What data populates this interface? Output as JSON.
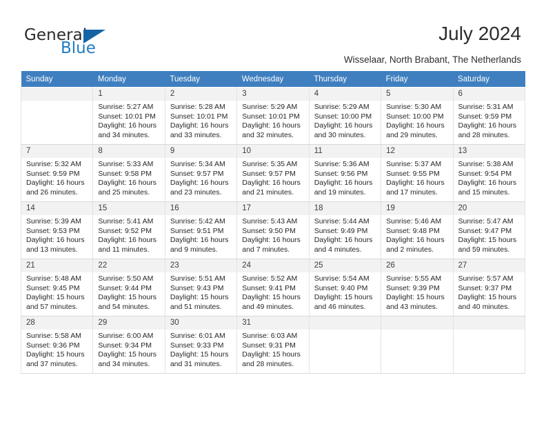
{
  "brand": {
    "name_top": "General",
    "name_bottom": "Blue",
    "accent_color": "#1464a5",
    "logo_icon": "triangle-icon"
  },
  "header": {
    "title": "July 2024",
    "subtitle": "Wisselaar, North Brabant, The Netherlands"
  },
  "calendar": {
    "header_bg": "#3f7fbf",
    "daynum_bg": "#f2f2f2",
    "weekdays": [
      "Sunday",
      "Monday",
      "Tuesday",
      "Wednesday",
      "Thursday",
      "Friday",
      "Saturday"
    ],
    "labels": {
      "sunrise": "Sunrise:",
      "sunset": "Sunset:",
      "daylight": "Daylight:"
    },
    "weeks": [
      [
        {
          "day": "",
          "empty": true
        },
        {
          "day": "1",
          "sunrise": "Sunrise: 5:27 AM",
          "sunset": "Sunset: 10:01 PM",
          "daylight": "Daylight: 16 hours and 34 minutes."
        },
        {
          "day": "2",
          "sunrise": "Sunrise: 5:28 AM",
          "sunset": "Sunset: 10:01 PM",
          "daylight": "Daylight: 16 hours and 33 minutes."
        },
        {
          "day": "3",
          "sunrise": "Sunrise: 5:29 AM",
          "sunset": "Sunset: 10:01 PM",
          "daylight": "Daylight: 16 hours and 32 minutes."
        },
        {
          "day": "4",
          "sunrise": "Sunrise: 5:29 AM",
          "sunset": "Sunset: 10:00 PM",
          "daylight": "Daylight: 16 hours and 30 minutes."
        },
        {
          "day": "5",
          "sunrise": "Sunrise: 5:30 AM",
          "sunset": "Sunset: 10:00 PM",
          "daylight": "Daylight: 16 hours and 29 minutes."
        },
        {
          "day": "6",
          "sunrise": "Sunrise: 5:31 AM",
          "sunset": "Sunset: 9:59 PM",
          "daylight": "Daylight: 16 hours and 28 minutes."
        }
      ],
      [
        {
          "day": "7",
          "sunrise": "Sunrise: 5:32 AM",
          "sunset": "Sunset: 9:59 PM",
          "daylight": "Daylight: 16 hours and 26 minutes."
        },
        {
          "day": "8",
          "sunrise": "Sunrise: 5:33 AM",
          "sunset": "Sunset: 9:58 PM",
          "daylight": "Daylight: 16 hours and 25 minutes."
        },
        {
          "day": "9",
          "sunrise": "Sunrise: 5:34 AM",
          "sunset": "Sunset: 9:57 PM",
          "daylight": "Daylight: 16 hours and 23 minutes."
        },
        {
          "day": "10",
          "sunrise": "Sunrise: 5:35 AM",
          "sunset": "Sunset: 9:57 PM",
          "daylight": "Daylight: 16 hours and 21 minutes."
        },
        {
          "day": "11",
          "sunrise": "Sunrise: 5:36 AM",
          "sunset": "Sunset: 9:56 PM",
          "daylight": "Daylight: 16 hours and 19 minutes."
        },
        {
          "day": "12",
          "sunrise": "Sunrise: 5:37 AM",
          "sunset": "Sunset: 9:55 PM",
          "daylight": "Daylight: 16 hours and 17 minutes."
        },
        {
          "day": "13",
          "sunrise": "Sunrise: 5:38 AM",
          "sunset": "Sunset: 9:54 PM",
          "daylight": "Daylight: 16 hours and 15 minutes."
        }
      ],
      [
        {
          "day": "14",
          "sunrise": "Sunrise: 5:39 AM",
          "sunset": "Sunset: 9:53 PM",
          "daylight": "Daylight: 16 hours and 13 minutes."
        },
        {
          "day": "15",
          "sunrise": "Sunrise: 5:41 AM",
          "sunset": "Sunset: 9:52 PM",
          "daylight": "Daylight: 16 hours and 11 minutes."
        },
        {
          "day": "16",
          "sunrise": "Sunrise: 5:42 AM",
          "sunset": "Sunset: 9:51 PM",
          "daylight": "Daylight: 16 hours and 9 minutes."
        },
        {
          "day": "17",
          "sunrise": "Sunrise: 5:43 AM",
          "sunset": "Sunset: 9:50 PM",
          "daylight": "Daylight: 16 hours and 7 minutes."
        },
        {
          "day": "18",
          "sunrise": "Sunrise: 5:44 AM",
          "sunset": "Sunset: 9:49 PM",
          "daylight": "Daylight: 16 hours and 4 minutes."
        },
        {
          "day": "19",
          "sunrise": "Sunrise: 5:46 AM",
          "sunset": "Sunset: 9:48 PM",
          "daylight": "Daylight: 16 hours and 2 minutes."
        },
        {
          "day": "20",
          "sunrise": "Sunrise: 5:47 AM",
          "sunset": "Sunset: 9:47 PM",
          "daylight": "Daylight: 15 hours and 59 minutes."
        }
      ],
      [
        {
          "day": "21",
          "sunrise": "Sunrise: 5:48 AM",
          "sunset": "Sunset: 9:45 PM",
          "daylight": "Daylight: 15 hours and 57 minutes."
        },
        {
          "day": "22",
          "sunrise": "Sunrise: 5:50 AM",
          "sunset": "Sunset: 9:44 PM",
          "daylight": "Daylight: 15 hours and 54 minutes."
        },
        {
          "day": "23",
          "sunrise": "Sunrise: 5:51 AM",
          "sunset": "Sunset: 9:43 PM",
          "daylight": "Daylight: 15 hours and 51 minutes."
        },
        {
          "day": "24",
          "sunrise": "Sunrise: 5:52 AM",
          "sunset": "Sunset: 9:41 PM",
          "daylight": "Daylight: 15 hours and 49 minutes."
        },
        {
          "day": "25",
          "sunrise": "Sunrise: 5:54 AM",
          "sunset": "Sunset: 9:40 PM",
          "daylight": "Daylight: 15 hours and 46 minutes."
        },
        {
          "day": "26",
          "sunrise": "Sunrise: 5:55 AM",
          "sunset": "Sunset: 9:39 PM",
          "daylight": "Daylight: 15 hours and 43 minutes."
        },
        {
          "day": "27",
          "sunrise": "Sunrise: 5:57 AM",
          "sunset": "Sunset: 9:37 PM",
          "daylight": "Daylight: 15 hours and 40 minutes."
        }
      ],
      [
        {
          "day": "28",
          "sunrise": "Sunrise: 5:58 AM",
          "sunset": "Sunset: 9:36 PM",
          "daylight": "Daylight: 15 hours and 37 minutes."
        },
        {
          "day": "29",
          "sunrise": "Sunrise: 6:00 AM",
          "sunset": "Sunset: 9:34 PM",
          "daylight": "Daylight: 15 hours and 34 minutes."
        },
        {
          "day": "30",
          "sunrise": "Sunrise: 6:01 AM",
          "sunset": "Sunset: 9:33 PM",
          "daylight": "Daylight: 15 hours and 31 minutes."
        },
        {
          "day": "31",
          "sunrise": "Sunrise: 6:03 AM",
          "sunset": "Sunset: 9:31 PM",
          "daylight": "Daylight: 15 hours and 28 minutes."
        },
        {
          "day": "",
          "empty": true
        },
        {
          "day": "",
          "empty": true
        },
        {
          "day": "",
          "empty": true
        }
      ]
    ]
  }
}
